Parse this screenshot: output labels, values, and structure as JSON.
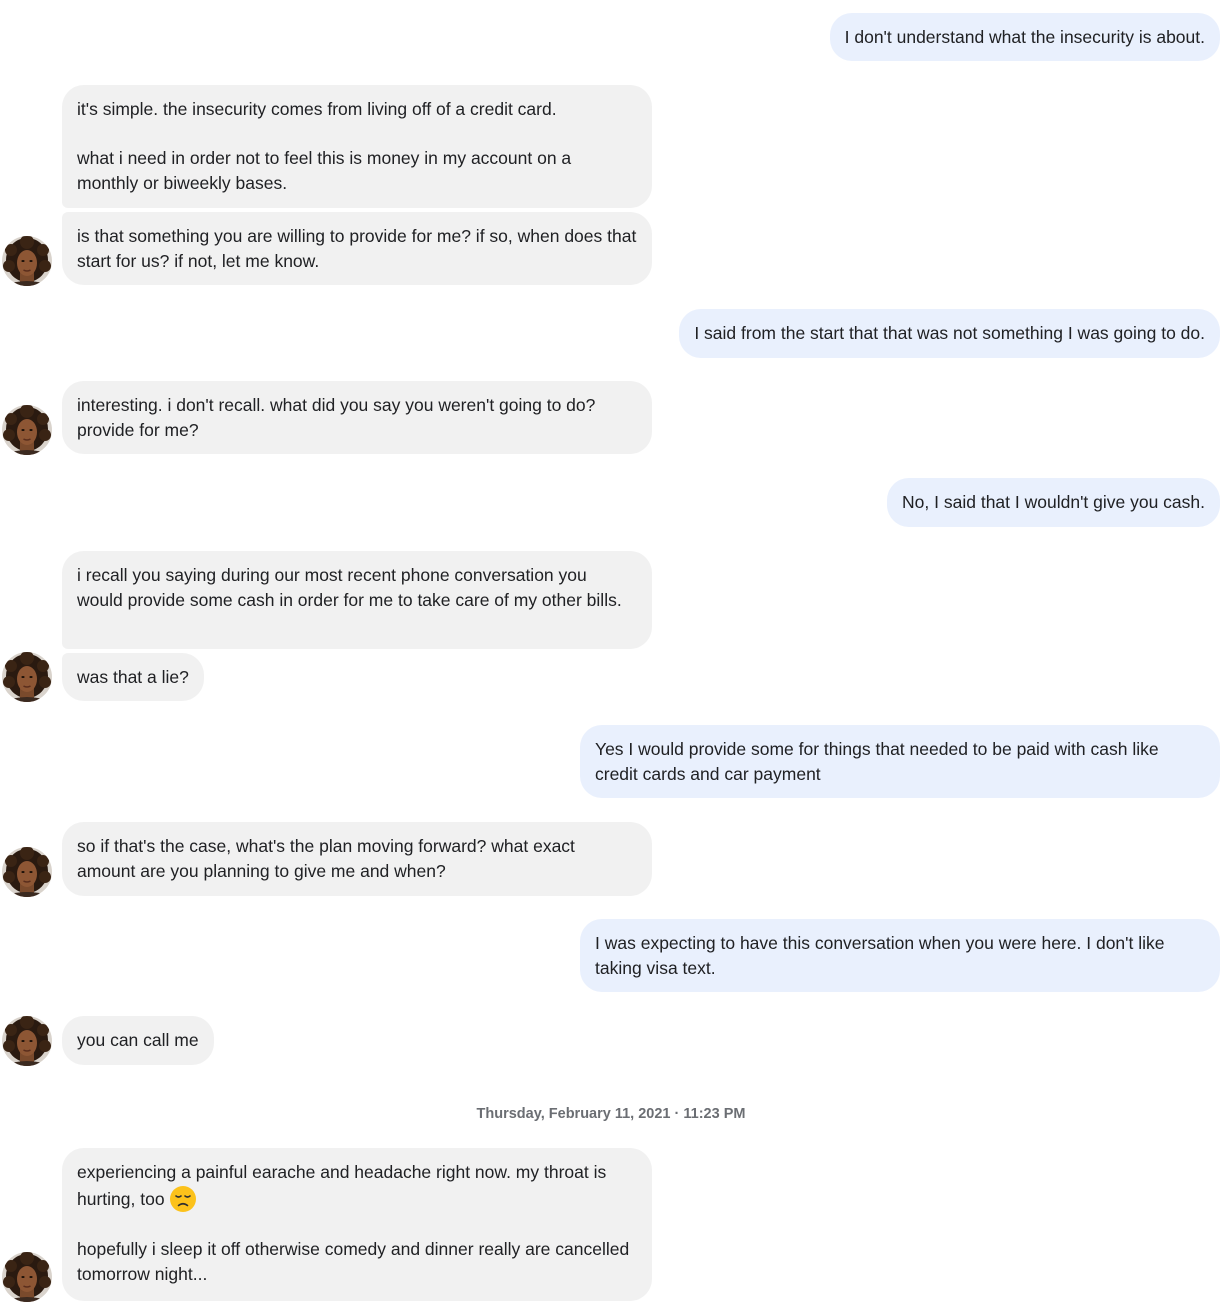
{
  "conversation": {
    "messages": [
      {
        "from": "me",
        "text": "I don't understand what the insecurity is about."
      },
      {
        "from": "them",
        "paragraphs": [
          "it's simple. the insecurity comes from living off of a credit card.",
          "what i need in order not to feel this is money in my account on a monthly or biweekly bases."
        ]
      },
      {
        "from": "them",
        "text": "is that something you are willing to provide for me? if so, when does that start for us? if not, let me know."
      },
      {
        "from": "me",
        "text": "I said from the start that that was not something I was going to do."
      },
      {
        "from": "them",
        "text": "interesting. i don't recall. what did you say you weren't going to do? provide for me?"
      },
      {
        "from": "me",
        "text": "No, I said that I wouldn't give you cash."
      },
      {
        "from": "them",
        "text": "i recall you saying during our most recent phone conversation you would provide some cash in order for me to take care of my other bills."
      },
      {
        "from": "them",
        "text": "was that a lie?"
      },
      {
        "from": "me",
        "text": "Yes I would provide some for things that needed to be paid with cash like credit cards and car payment"
      },
      {
        "from": "them",
        "text": "so if that's the case, what's the plan moving forward? what exact amount are you planning to give me and when?"
      },
      {
        "from": "me",
        "text": "I was expecting to have this conversation when you were here. I don't like taking visa text."
      },
      {
        "from": "them",
        "text": "you can call me"
      },
      {
        "from": "them",
        "paragraphs": [
          "experiencing a painful earache and headache right now. my throat is hurting, too",
          "hopefully i sleep it off otherwise comedy and dinner really are cancelled tomorrow night..."
        ],
        "emoji": "disappointed-face-icon"
      }
    ],
    "timestamp": "Thursday, February 11, 2021 · 11:23 PM"
  },
  "colors": {
    "incoming_bubble": "#f1f1f1",
    "outgoing_bubble": "#e9f0fd",
    "text": "#202124",
    "timestamp": "#6b6e73"
  }
}
